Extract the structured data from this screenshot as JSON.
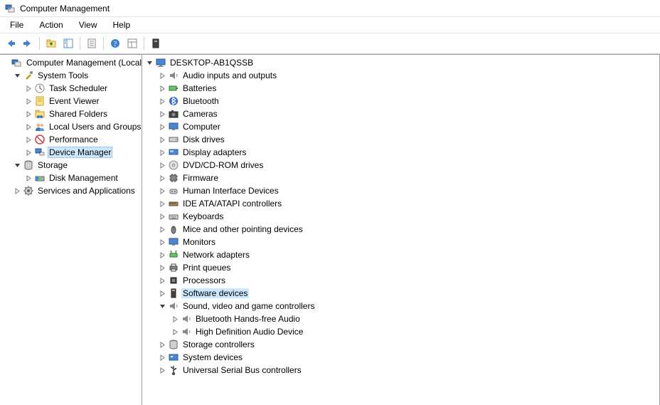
{
  "window": {
    "title": "Computer Management"
  },
  "menubar": [
    "File",
    "Action",
    "View",
    "Help"
  ],
  "left_tree": {
    "root": {
      "label": "Computer Management (Local)",
      "children": [
        {
          "label": "System Tools",
          "expanded": true,
          "children": [
            {
              "label": "Task Scheduler"
            },
            {
              "label": "Event Viewer"
            },
            {
              "label": "Shared Folders"
            },
            {
              "label": "Local Users and Groups"
            },
            {
              "label": "Performance"
            },
            {
              "label": "Device Manager",
              "selected": true
            }
          ]
        },
        {
          "label": "Storage",
          "expanded": true,
          "children": [
            {
              "label": "Disk Management"
            }
          ]
        },
        {
          "label": "Services and Applications"
        }
      ]
    }
  },
  "right_tree": {
    "root": {
      "label": "DESKTOP-AB1QSSB",
      "expanded": true,
      "children": [
        {
          "label": "Audio inputs and outputs",
          "icon": "speaker"
        },
        {
          "label": "Batteries",
          "icon": "battery"
        },
        {
          "label": "Bluetooth",
          "icon": "bluetooth"
        },
        {
          "label": "Cameras",
          "icon": "camera"
        },
        {
          "label": "Computer",
          "icon": "monitor"
        },
        {
          "label": "Disk drives",
          "icon": "disk"
        },
        {
          "label": "Display adapters",
          "icon": "display"
        },
        {
          "label": "DVD/CD-ROM drives",
          "icon": "dvd"
        },
        {
          "label": "Firmware",
          "icon": "chip"
        },
        {
          "label": "Human Interface Devices",
          "icon": "hid"
        },
        {
          "label": "IDE ATA/ATAPI controllers",
          "icon": "ide"
        },
        {
          "label": "Keyboards",
          "icon": "keyboard"
        },
        {
          "label": "Mice and other pointing devices",
          "icon": "mouse"
        },
        {
          "label": "Monitors",
          "icon": "monitor"
        },
        {
          "label": "Network adapters",
          "icon": "network"
        },
        {
          "label": "Print queues",
          "icon": "printer"
        },
        {
          "label": "Processors",
          "icon": "cpu"
        },
        {
          "label": "Software devices",
          "icon": "software",
          "highlight": true
        },
        {
          "label": "Sound, video and game controllers",
          "icon": "speaker",
          "expanded": true,
          "children": [
            {
              "label": "Bluetooth Hands-free Audio",
              "icon": "speaker"
            },
            {
              "label": "High Definition Audio Device",
              "icon": "speaker"
            }
          ]
        },
        {
          "label": "Storage controllers",
          "icon": "storage"
        },
        {
          "label": "System devices",
          "icon": "system"
        },
        {
          "label": "Universal Serial Bus controllers",
          "icon": "usb"
        }
      ]
    }
  }
}
